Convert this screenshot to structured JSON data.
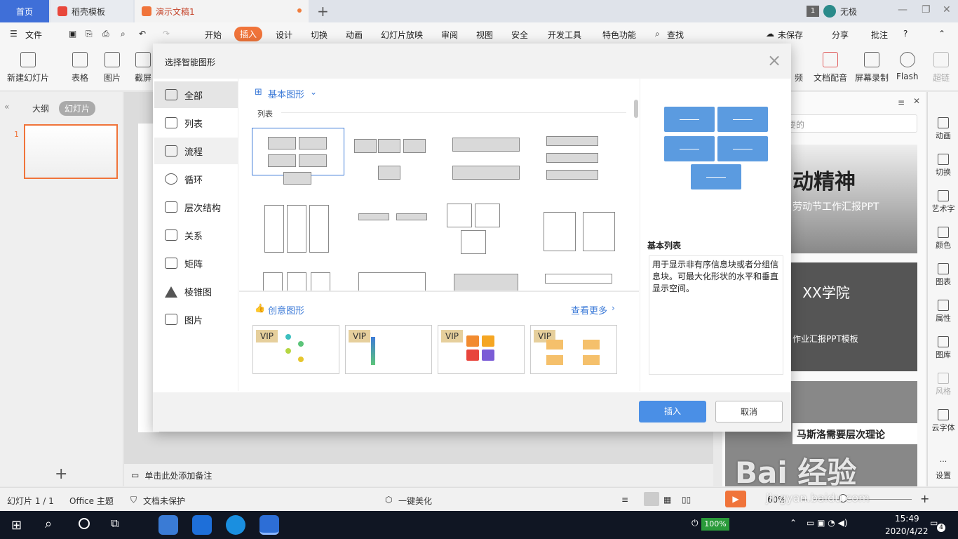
{
  "tabs": {
    "home": "首页",
    "template": "稻壳模板",
    "doc": "演示文稿1",
    "badge": "1",
    "user": "无极"
  },
  "menu": {
    "file": "文件",
    "items": [
      "开始",
      "插入",
      "设计",
      "切换",
      "动画",
      "幻灯片放映",
      "审阅",
      "视图",
      "安全",
      "开发工具",
      "特色功能"
    ],
    "search": "查找",
    "unsaved": "未保存",
    "share": "分享",
    "comment": "批注",
    "help": "?"
  },
  "toolbar": {
    "new_slide": "新建幻灯片",
    "table": "表格",
    "image": "图片",
    "screenshot": "截屏",
    "audio_frag": "频",
    "voiceover": "文档配音",
    "screen_record": "屏幕录制",
    "flash": "Flash",
    "hyperlink": "超链"
  },
  "leftpane": {
    "outline": "大纲",
    "slides": "幻灯片",
    "slide_num": "1"
  },
  "notes": "单击此处添加备注",
  "rightpane": {
    "search_placeholder": "要的",
    "cards": [
      {
        "title": "动精神",
        "subtitle": "劳动节工作汇报PPT"
      },
      {
        "title": "XX学院",
        "subtitle": "作业汇报PPT模板"
      },
      {
        "title": "马斯洛需要层次理论"
      }
    ]
  },
  "rightbar": [
    "动画",
    "切换",
    "艺术字",
    "颜色",
    "图表",
    "属性",
    "图库",
    "风格",
    "云字体",
    "设置"
  ],
  "status": {
    "slide": "幻灯片 1 / 1",
    "theme": "Office 主题",
    "protect": "文档未保护",
    "beautify": "一键美化",
    "zoom": "60%"
  },
  "watermark": "Bai 经验",
  "watermark_url": "jingyan.baidu.com",
  "taskbar": {
    "time": "15:49",
    "date": "2020/4/22",
    "battery": "100%",
    "notif": "4"
  },
  "dialog": {
    "title": "选择智能图形",
    "categories": [
      "全部",
      "列表",
      "流程",
      "循环",
      "层次结构",
      "关系",
      "矩阵",
      "棱锥图",
      "图片"
    ],
    "section_basic": "基本图形",
    "sublabel": "列表",
    "section_creative": "创意图形",
    "see_more": "查看更多",
    "vip": "VIP",
    "preview_title": "基本列表",
    "preview_desc": "用于显示非有序信息块或者分组信息块。可最大化形状的水平和垂直显示空间。",
    "insert": "插入",
    "cancel": "取消"
  },
  "colors": {
    "accent": "#f0743a",
    "blue": "#3d7bd8",
    "preview": "#5b9be0"
  }
}
